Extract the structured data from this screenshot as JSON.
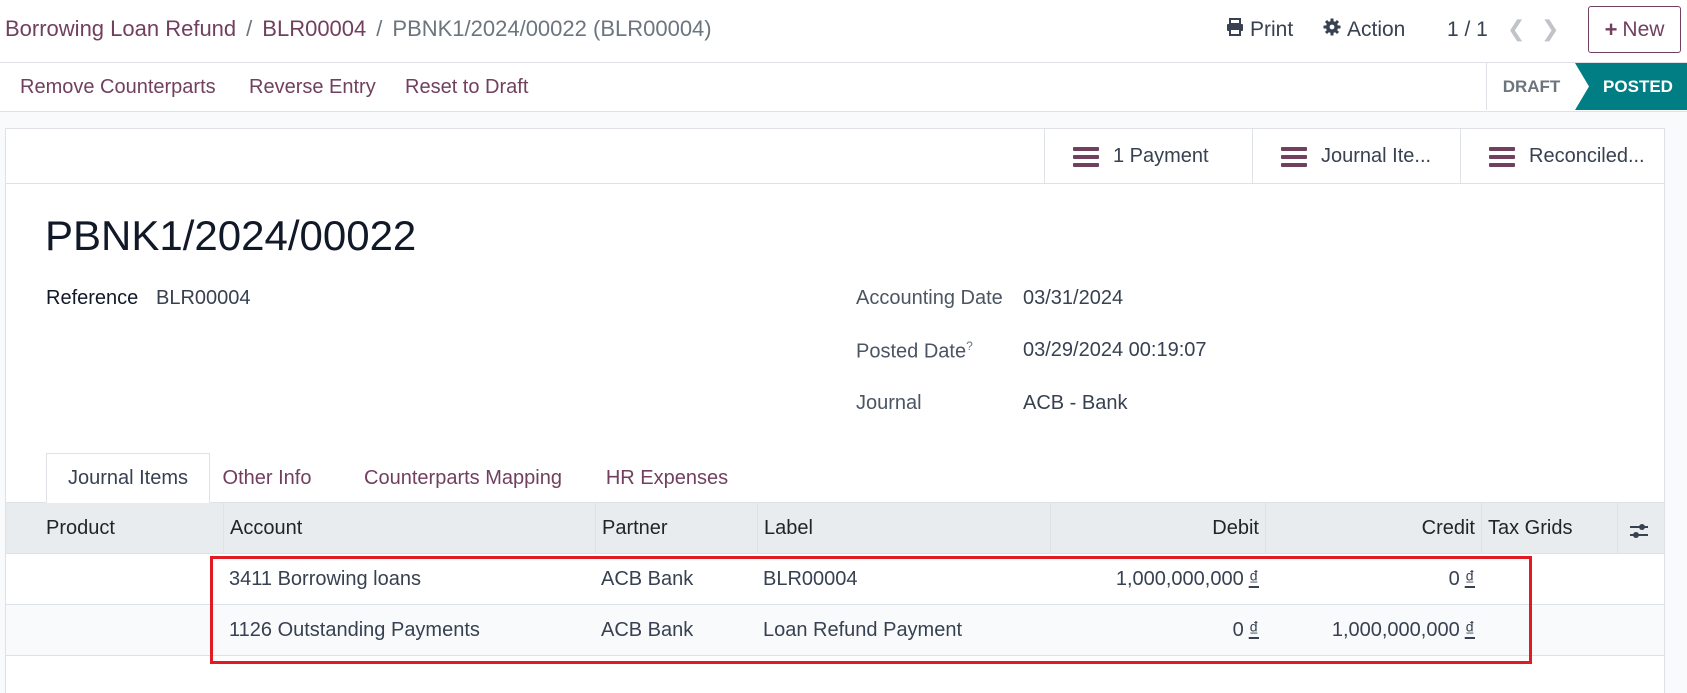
{
  "breadcrumb": {
    "items": [
      "Borrowing Loan Refund",
      "BLR00004"
    ],
    "current": "PBNK1/2024/00022 (BLR00004)",
    "separator": "/"
  },
  "toolbar": {
    "print_label": "Print",
    "action_label": "Action",
    "pager": "1 / 1",
    "new_label": "New"
  },
  "actions": {
    "remove_counterparts": "Remove Counterparts",
    "reverse_entry": "Reverse Entry",
    "reset_to_draft": "Reset to Draft"
  },
  "status": {
    "stages": [
      "DRAFT",
      "POSTED"
    ],
    "current": "POSTED"
  },
  "smart_buttons": {
    "payment": "1 Payment",
    "journal_items": "Journal Ite...",
    "reconciled": "Reconciled..."
  },
  "record": {
    "title": "PBNK1/2024/00022",
    "reference_label": "Reference",
    "reference_value": "BLR00004",
    "accounting_date_label": "Accounting Date",
    "accounting_date_value": "03/31/2024",
    "posted_date_label": "Posted Date",
    "posted_date_help": "?",
    "posted_date_value": "03/29/2024 00:19:07",
    "journal_label": "Journal",
    "journal_value": "ACB - Bank"
  },
  "tabs": [
    "Journal Items",
    "Other Info",
    "Counterparts Mapping",
    "HR Expenses"
  ],
  "table": {
    "headers": {
      "product": "Product",
      "account": "Account",
      "partner": "Partner",
      "label": "Label",
      "debit": "Debit",
      "credit": "Credit",
      "tax_grids": "Tax Grids"
    },
    "currency_symbol": "₫",
    "rows": [
      {
        "product": "",
        "account": "3411 Borrowing loans",
        "partner": "ACB Bank",
        "label": "BLR00004",
        "debit": "1,000,000,000",
        "credit": "0"
      },
      {
        "product": "",
        "account": "1126 Outstanding Payments",
        "partner": "ACB Bank",
        "label": "Loan Refund Payment",
        "debit": "0",
        "credit": "1,000,000,000"
      }
    ]
  },
  "colors": {
    "brand": "#71405f",
    "posted": "#017e84",
    "highlight": "#e01b24"
  },
  "icons": [
    "printer-icon",
    "gear-icon",
    "chevron-left-icon",
    "chevron-right-icon",
    "plus-icon",
    "list-icon",
    "column-settings-icon"
  ]
}
